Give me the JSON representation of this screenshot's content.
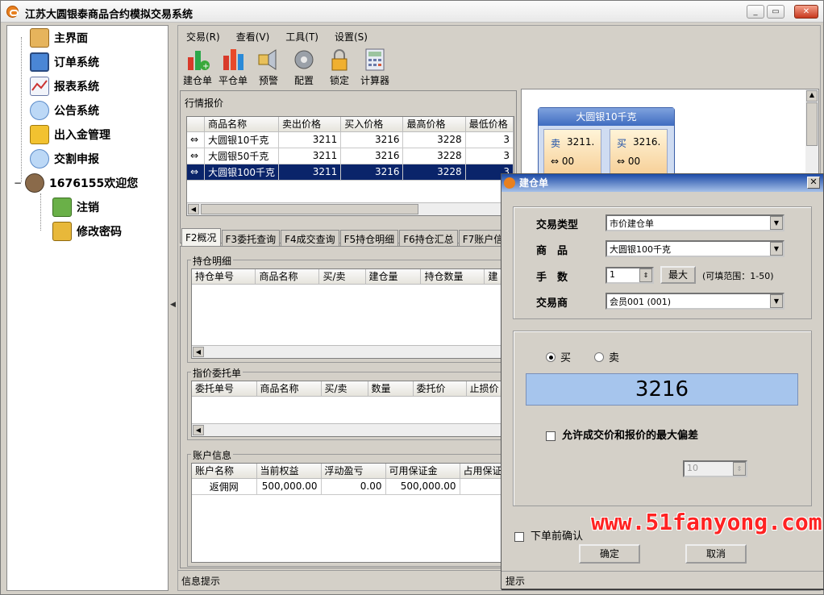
{
  "window": {
    "title": "江苏大圆银泰商品合约模拟交易系统"
  },
  "sidebar": {
    "items": [
      {
        "label": "主界面",
        "icon": "home-icon"
      },
      {
        "label": "订单系统",
        "icon": "monitor-icon"
      },
      {
        "label": "报表系统",
        "icon": "chart-icon"
      },
      {
        "label": "公告系统",
        "icon": "chat-bubble-icon"
      },
      {
        "label": "出入金管理",
        "icon": "coins-icon"
      },
      {
        "label": "交割申报",
        "icon": "chat-bubble-icon"
      },
      {
        "label": "1676155欢迎您",
        "icon": "user-cup-icon"
      }
    ],
    "children": [
      {
        "label": "注销",
        "icon": "person-icon"
      },
      {
        "label": "修改密码",
        "icon": "key-icon"
      }
    ]
  },
  "menu": [
    "交易(R)",
    "查看(V)",
    "工具(T)",
    "设置(S)"
  ],
  "toolbar": [
    "建仓单",
    "平仓单",
    "预警",
    "配置",
    "锁定",
    "计算器"
  ],
  "quotes": {
    "title": "行情报价",
    "columns": [
      "商品名称",
      "卖出价格",
      "买入价格",
      "最高价格",
      "最低价格"
    ],
    "rows": [
      {
        "name": "大圆银10千克",
        "sell": "3211",
        "buy": "3216",
        "high": "3228",
        "low": "3"
      },
      {
        "name": "大圆银50千克",
        "sell": "3211",
        "buy": "3216",
        "high": "3228",
        "low": "3"
      },
      {
        "name": "大圆银100千克",
        "sell": "3211",
        "buy": "3216",
        "high": "3228",
        "low": "3"
      }
    ]
  },
  "tabs": [
    "F2概况",
    "F3委托查询",
    "F4成交查询",
    "F5持仓明细",
    "F6持仓汇总",
    "F7账户信"
  ],
  "positions": {
    "title": "持仓明细",
    "columns": [
      "持仓单号",
      "商品名称",
      "买/卖",
      "建仓量",
      "持仓数量",
      "建"
    ]
  },
  "orders": {
    "title": "指价委托单",
    "columns": [
      "委托单号",
      "商品名称",
      "买/卖",
      "数量",
      "委托价",
      "止损价"
    ]
  },
  "account": {
    "title": "账户信息",
    "columns": [
      "账户名称",
      "当前权益",
      "浮动盈亏",
      "可用保证金",
      "占用保证"
    ],
    "row": {
      "name": "返佣网",
      "equity": "500,000.00",
      "floating": "0.00",
      "available": "500,000.00"
    }
  },
  "status_bar": "信息提示",
  "quote_card": {
    "title": "大圆银10千克",
    "sell_label": "卖",
    "sell_value": "3211.",
    "buy_label": "买",
    "buy_value": "3216.",
    "sell_sub": "00",
    "buy_sub": "00"
  },
  "dialog": {
    "title": "建仓单",
    "trade_type_label": "交易类型",
    "trade_type_value": "市价建仓单",
    "commodity_label": "商　品",
    "commodity_value": "大圆银100千克",
    "lots_label": "手　数",
    "lots_value": "1",
    "max_button": "最大",
    "range_text": "(可填范围：1-50)",
    "dealer_label": "交易商",
    "dealer_value": "会员001 (001)",
    "buy_label": "买",
    "sell_label": "卖",
    "selected_side": "buy",
    "price": "3216",
    "allow_deviation_label": "允许成交价和报价的最大偏差",
    "deviation_value": "10",
    "confirm_before_label": "下单前确认",
    "ok_button": "确定",
    "cancel_button": "取消",
    "status": "提示"
  },
  "watermark": "www.51fanyong.com"
}
